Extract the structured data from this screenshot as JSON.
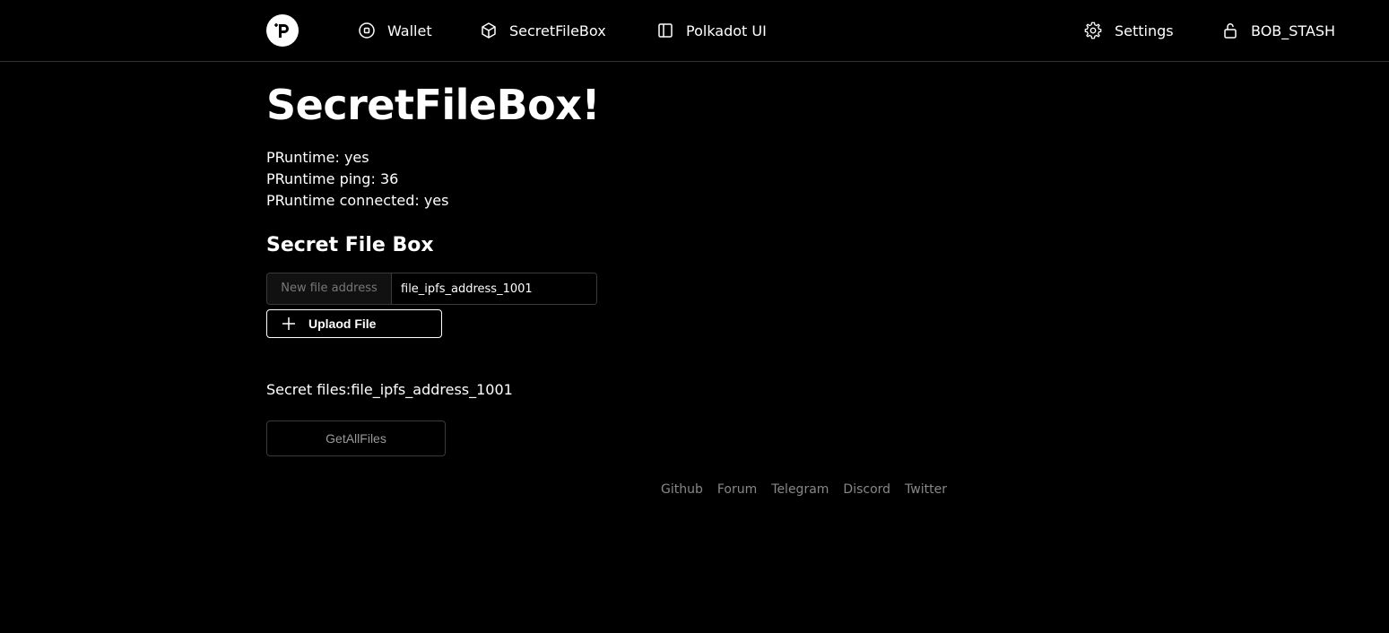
{
  "nav": {
    "wallet": "Wallet",
    "secret_file_box": "SecretFileBox",
    "polkadot_ui": "Polkadot UI",
    "settings": "Settings",
    "account": "BOB_STASH"
  },
  "main": {
    "title": "SecretFileBox!",
    "status": [
      "PRuntime: yes",
      "PRuntime ping: 36",
      "PRuntime connected: yes"
    ],
    "section_title": "Secret File Box",
    "file_input": {
      "addon_label": "New file address",
      "value": "file_ipfs_address_1001"
    },
    "upload_button": "Uplaod File",
    "secret_files_text": "Secret files:file_ipfs_address_1001",
    "get_all_button": "GetAllFiles"
  },
  "footer": {
    "links": [
      "Github",
      "Forum",
      "Telegram",
      "Discord",
      "Twitter"
    ]
  },
  "icons": {
    "logo": "phala-logo-icon",
    "wallet": "wallet-icon",
    "secret_file_box": "box-icon",
    "polkadot_ui": "sidebar-icon",
    "settings": "gear-icon",
    "account": "unlock-icon",
    "upload": "plus-icon"
  },
  "colors": {
    "background": "#000000",
    "text": "#ffffff",
    "muted": "#888888",
    "border": "#3a3a3a"
  }
}
